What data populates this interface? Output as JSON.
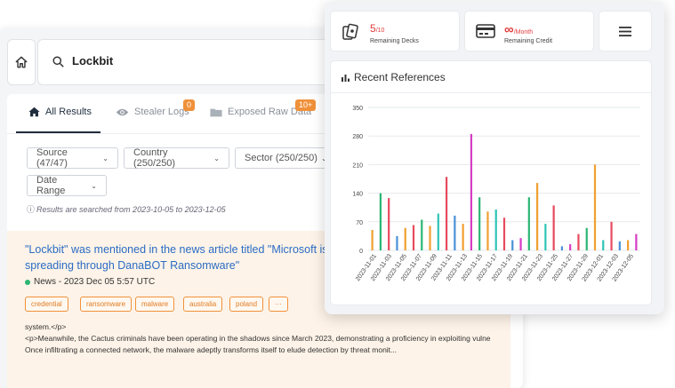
{
  "search": {
    "query": "Lockbit"
  },
  "tabs": [
    {
      "label": "All Results"
    },
    {
      "label": "Stealer Logs",
      "badge": "0"
    },
    {
      "label": "Exposed Raw Data",
      "badge": "10+"
    }
  ],
  "filters": {
    "source": "Source (47/47)",
    "country": "Country (250/250)",
    "sector": "Sector (250/250)",
    "date_range": "Date Range"
  },
  "search_note": "Results are searched from 2023-10-05 to 2023-12-05",
  "result": {
    "title_line1": "\"Lockbit\" was mentioned in the news article titled \"Microsoft issue",
    "title_line2": "spreading through DanaBOT Ransomware\"",
    "meta": "News - 2023 Dec 05 5:57 UTC",
    "tags": [
      "credential",
      "ransomware",
      "malware",
      "australia",
      "poland",
      "···"
    ],
    "snippet_line1": "system.</p>",
    "snippet_line2": "<p>Meanwhile, the Cactus criminals have been operating in the shadows since March 2023, demonstrating a proficiency in exploiting vulne",
    "snippet_line3": "Once infiltrating a connected network, the malware adeptly transforms itself to elude detection by threat monit..."
  },
  "stats": {
    "decks_value": "5",
    "decks_total": "/10",
    "decks_label": "Remaining Decks",
    "credit_value": "∞",
    "credit_unit": "/Month",
    "credit_label": "Remaining Credit"
  },
  "chart_title": "Recent References",
  "colors": {
    "accent_orange": "#f0913a",
    "link_blue": "#2b6cc4",
    "stat_red": "#e23b3b",
    "news_green": "#2bb673"
  },
  "icons": {
    "home": "home-icon",
    "search": "search-icon",
    "all_results": "home-icon",
    "stealer": "eye-icon",
    "exposed": "folder-icon",
    "decks": "cards-icon",
    "credit": "credit-card-icon",
    "menu": "hamburger-menu-icon",
    "chart": "bar-chart-icon"
  },
  "chart_data": {
    "type": "bar",
    "title": "Recent References",
    "xlabel": "",
    "ylabel": "",
    "ylim": [
      0,
      350
    ],
    "yticks": [
      0,
      70,
      140,
      210,
      280,
      350
    ],
    "grid": true,
    "x_tick_labels": [
      "2023-11-01",
      "2023-11-03",
      "2023-11-05",
      "2023-11-07",
      "2023-11-09",
      "2023-11-11",
      "2023-11-13",
      "2023-11-15",
      "2023-11-17",
      "2023-11-19",
      "2023-11-21",
      "2023-11-23",
      "2023-11-25",
      "2023-11-27",
      "2023-11-29",
      "2023-12-01",
      "2023-12-03",
      "2023-12-05"
    ],
    "bars": [
      {
        "value": 50,
        "color": "#f0a030"
      },
      {
        "value": 140,
        "color": "#2bb673"
      },
      {
        "value": 128,
        "color": "#e84a5f"
      },
      {
        "value": 35,
        "color": "#4a90d9"
      },
      {
        "value": 55,
        "color": "#f0a030"
      },
      {
        "value": 62,
        "color": "#e84a5f"
      },
      {
        "value": 75,
        "color": "#2bb673"
      },
      {
        "value": 60,
        "color": "#f0a030"
      },
      {
        "value": 90,
        "color": "#2ec4b6"
      },
      {
        "value": 180,
        "color": "#e84a5f"
      },
      {
        "value": 85,
        "color": "#4a90d9"
      },
      {
        "value": 65,
        "color": "#f0a030"
      },
      {
        "value": 285,
        "color": "#d63cc4"
      },
      {
        "value": 130,
        "color": "#2bb673"
      },
      {
        "value": 95,
        "color": "#f0a030"
      },
      {
        "value": 100,
        "color": "#2ec4b6"
      },
      {
        "value": 80,
        "color": "#e84a5f"
      },
      {
        "value": 25,
        "color": "#4a90d9"
      },
      {
        "value": 30,
        "color": "#d63cc4"
      },
      {
        "value": 130,
        "color": "#2bb673"
      },
      {
        "value": 165,
        "color": "#f0a030"
      },
      {
        "value": 65,
        "color": "#2ec4b6"
      },
      {
        "value": 110,
        "color": "#e84a5f"
      },
      {
        "value": 10,
        "color": "#4a90d9"
      },
      {
        "value": 15,
        "color": "#d63cc4"
      },
      {
        "value": 40,
        "color": "#e84a5f"
      },
      {
        "value": 55,
        "color": "#2bb673"
      },
      {
        "value": 210,
        "color": "#f0a030"
      },
      {
        "value": 25,
        "color": "#2ec4b6"
      },
      {
        "value": 70,
        "color": "#e84a5f"
      },
      {
        "value": 22,
        "color": "#4a90d9"
      },
      {
        "value": 25,
        "color": "#f0a030"
      },
      {
        "value": 40,
        "color": "#d63cc4"
      }
    ]
  }
}
